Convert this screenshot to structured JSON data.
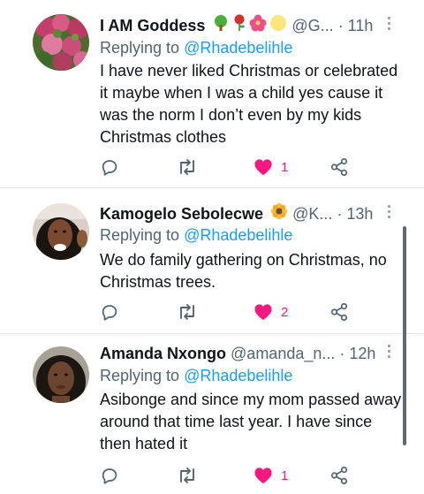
{
  "reply_prefix": "Replying to",
  "tweets": [
    {
      "name": "I AM Goddess",
      "handle": "@G...",
      "time": "· 11h",
      "mention": "@Rhadebelihle",
      "text": "I have never liked Christmas or celebrated it  maybe when I was a child yes cause it was the norm I don’t even by my kids Christmas clothes",
      "likes": "1"
    },
    {
      "name": "Kamogelo Sebolecwe",
      "handle": "@K...",
      "time": "· 13h",
      "mention": "@Rhadebelihle",
      "text": "We do family gathering on Christmas, no Christmas trees.",
      "likes": "2"
    },
    {
      "name": "Amanda Nxongo",
      "handle": "@amanda_n...",
      "time": "· 12h",
      "mention": "@Rhadebelihle",
      "text": "Asibonge and since my mom passed away around that time last year. I have since then hated it",
      "likes": "1"
    }
  ],
  "colors": {
    "like": "#f91880",
    "mention": "#1d9bf0",
    "secondary": "#536471"
  }
}
